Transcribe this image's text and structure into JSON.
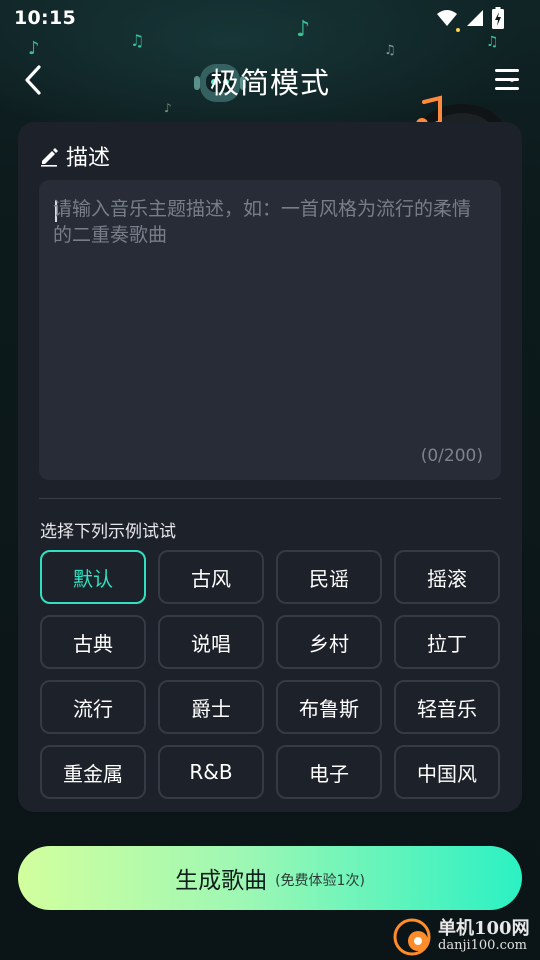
{
  "status_bar": {
    "time": "10:15"
  },
  "header": {
    "title": "极简模式"
  },
  "description": {
    "title": "描述",
    "placeholder": "请输入音乐主题描述，如：一首风格为流行的柔情的二重奏歌曲",
    "char_count": "(0/200)"
  },
  "examples": {
    "label": "选择下列示例试试",
    "tags": [
      {
        "label": "默认",
        "selected": true
      },
      {
        "label": "古风",
        "selected": false
      },
      {
        "label": "民谣",
        "selected": false
      },
      {
        "label": "摇滚",
        "selected": false
      },
      {
        "label": "古典",
        "selected": false
      },
      {
        "label": "说唱",
        "selected": false
      },
      {
        "label": "乡村",
        "selected": false
      },
      {
        "label": "拉丁",
        "selected": false
      },
      {
        "label": "流行",
        "selected": false
      },
      {
        "label": "爵士",
        "selected": false
      },
      {
        "label": "布鲁斯",
        "selected": false
      },
      {
        "label": "轻音乐",
        "selected": false
      },
      {
        "label": "重金属",
        "selected": false
      },
      {
        "label": "R&B",
        "selected": false
      },
      {
        "label": "电子",
        "selected": false
      },
      {
        "label": "中国风",
        "selected": false
      }
    ]
  },
  "generate": {
    "label": "生成歌曲",
    "note": "(免费体验1次)"
  },
  "watermark": {
    "name": "单机100网",
    "url": "danji100.com"
  },
  "colors": {
    "accent": "#2fe0c1",
    "card": "#1d2129",
    "input": "#272c36",
    "button_start": "#d2ff9e",
    "button_end": "#2bf1c3"
  }
}
